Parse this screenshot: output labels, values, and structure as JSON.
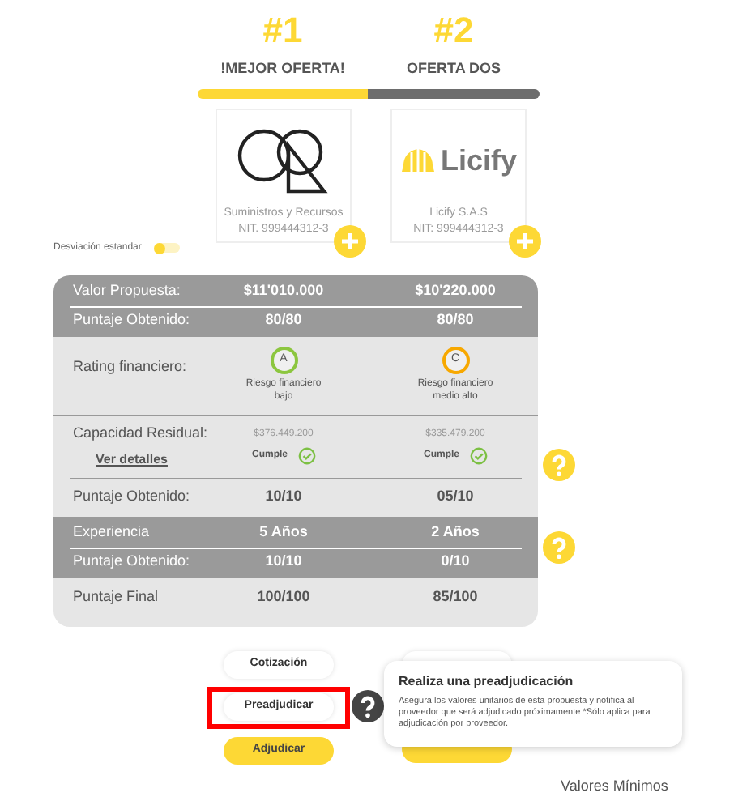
{
  "offers": [
    {
      "rank": "#1",
      "label": "!MEJOR OFERTA!",
      "selected": true,
      "kind": "rings",
      "name": "Suministros y Recursos",
      "nit": "NIT. 999444312-3"
    },
    {
      "rank": "#2",
      "label": "OFERTA DOS",
      "selected": false,
      "kind": "licify",
      "logo_text": "Licify",
      "name": "Licify S.A.S",
      "nit": "NIT: 999444312-3"
    }
  ],
  "toggle": {
    "label": "Desviación estandar",
    "on": false
  },
  "sections": [
    {
      "kind": "dark",
      "help": false,
      "rows": [
        {
          "kind": "text",
          "label": "Valor Propuesta:",
          "values": [
            "$11'010.000",
            "$10'220.000"
          ]
        },
        {
          "kind": "text",
          "label": "Puntaje Obtenido:",
          "values": [
            "80/80",
            "80/80"
          ]
        }
      ]
    },
    {
      "kind": "light",
      "help": false,
      "rows": [
        {
          "kind": "rating",
          "label": "Rating financiero:",
          "ratings": [
            {
              "grade": "A",
              "color": "#8cc63f",
              "caption": "Riesgo financiero bajo"
            },
            {
              "grade": "C",
              "color": "#f7a800",
              "caption": "Riesgo financiero medio alto"
            }
          ]
        }
      ]
    },
    {
      "kind": "light",
      "help": true,
      "rows": [
        {
          "kind": "capacity",
          "label": "Capacidad Residual:",
          "link": "Ver detalles",
          "items": [
            {
              "amount": "$376.449.200",
              "status": "Cumple"
            },
            {
              "amount": "$335.479.200",
              "status": "Cumple"
            }
          ]
        },
        {
          "kind": "text",
          "label": "Puntaje Obtenido:",
          "values": [
            "10/10",
            "05/10"
          ]
        }
      ]
    },
    {
      "kind": "dark",
      "help": true,
      "rows": [
        {
          "kind": "text",
          "label": "Experiencia",
          "values": [
            "5 Años",
            "2 Años"
          ]
        },
        {
          "kind": "text",
          "label": "Puntaje Obtenido:",
          "values": [
            "10/10",
            "0/10"
          ]
        }
      ]
    },
    {
      "kind": "light",
      "help": false,
      "rows": [
        {
          "kind": "text",
          "label": "Puntaje Final",
          "values": [
            "100/100",
            "85/100"
          ]
        }
      ]
    }
  ],
  "actions": [
    {
      "kind": "plain",
      "label": "Cotización",
      "highlighted": false
    },
    {
      "kind": "plain",
      "label": "Preadjudicar",
      "highlighted": true
    },
    {
      "kind": "primary",
      "label": "Adjudicar",
      "highlighted": false
    }
  ],
  "tooltip": {
    "title": "Realiza una preadjudicación",
    "text": "Asegura los valores unitarios de esta propuesta y notifica al proveedor que será adjudicado próximamente *Sólo aplica para adjudicación por proveedor."
  },
  "footer": "Valores Mínimos"
}
